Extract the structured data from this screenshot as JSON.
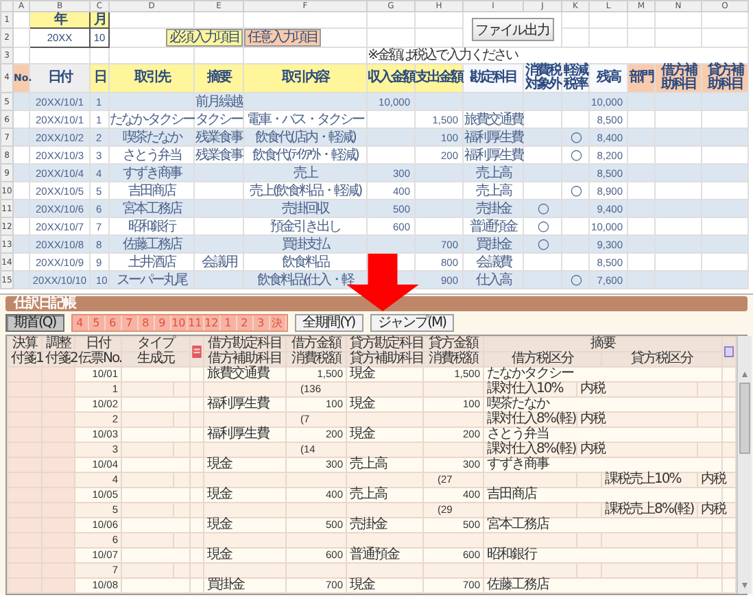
{
  "sheet": {
    "column_letters": [
      "A",
      "B",
      "C",
      "D",
      "E",
      "F",
      "G",
      "H",
      "I",
      "J",
      "K",
      "L",
      "M",
      "N",
      "O"
    ],
    "row_numbers": [
      "1",
      "2",
      "3",
      "4",
      "5",
      "6",
      "7",
      "8",
      "9",
      "10",
      "11",
      "12",
      "13",
      "14",
      "15"
    ],
    "year_label": "年",
    "month_label": "月",
    "year": "20XX",
    "month": "10",
    "legend": [
      {
        "label": "必須入力項目",
        "kind": "required"
      },
      {
        "label": "任意入力項目",
        "kind": "optional"
      }
    ],
    "export_button": "ファイル出力",
    "note": "※金額は税込で入力ください",
    "columns": [
      {
        "label": "No.",
        "kind": "optional"
      },
      {
        "label": "日付",
        "kind": "auto"
      },
      {
        "label": "日",
        "kind": "required"
      },
      {
        "label": "取引先",
        "kind": "required"
      },
      {
        "label": "摘要",
        "kind": "required"
      },
      {
        "label": "取引内容",
        "kind": "required"
      },
      {
        "label": "収入金額",
        "kind": "required"
      },
      {
        "label": "支出金額",
        "kind": "required"
      },
      {
        "label": "勘定科目",
        "kind": "computed"
      },
      {
        "label": "消費税対象外",
        "kind": "computed"
      },
      {
        "label": "軽減税率",
        "kind": "computed"
      },
      {
        "label": "残高",
        "kind": "computed"
      },
      {
        "label": "部門",
        "kind": "optional"
      },
      {
        "label": "借方補助科目",
        "kind": "optional"
      },
      {
        "label": "貸方補助科目",
        "kind": "optional"
      }
    ],
    "rows": [
      {
        "date": "20XX/10/1",
        "day": "1",
        "summary": "前月繰越",
        "income": "10,000",
        "balance": "10,000"
      },
      {
        "date": "20XX/10/1",
        "day": "1",
        "partner": "たなか-タクシー",
        "summary": "タクシー",
        "content": "電車・バス・タクシー",
        "expense": "1,500",
        "account": "旅費交通費",
        "balance": "8,500"
      },
      {
        "date": "20XX/10/2",
        "day": "2",
        "partner": "喫茶たなか",
        "summary": "残業食事",
        "content": "飲食代(店内・軽減)",
        "expense": "100",
        "account": "福利厚生費",
        "reduced_rate": "○",
        "balance": "8,400"
      },
      {
        "date": "20XX/10/3",
        "day": "3",
        "partner": "さとう弁当",
        "summary": "残業食事",
        "content": "飲食代(ﾃｲｸｱｳﾄ・軽減)",
        "expense": "200",
        "account": "福利厚生費",
        "reduced_rate": "○",
        "balance": "8,200"
      },
      {
        "date": "20XX/10/4",
        "day": "4",
        "partner": "すずき商事",
        "content": "売上",
        "income": "300",
        "account": "売上高",
        "balance": "8,500"
      },
      {
        "date": "20XX/10/5",
        "day": "5",
        "partner": "吉田商店",
        "content": "売上(飲食料品・軽減)",
        "income": "400",
        "account": "売上高",
        "reduced_rate": "○",
        "balance": "8,900"
      },
      {
        "date": "20XX/10/6",
        "day": "6",
        "partner": "宮本工務店",
        "content": "売掛回収",
        "income": "500",
        "account": "売掛金",
        "tax_exempt": "○",
        "balance": "9,400"
      },
      {
        "date": "20XX/10/7",
        "day": "7",
        "partner": "昭和銀行",
        "content": "預金引き出し",
        "income": "600",
        "account": "普通預金",
        "tax_exempt": "○",
        "balance": "10,000"
      },
      {
        "date": "20XX/10/8",
        "day": "8",
        "partner": "佐藤工務店",
        "content": "買掛支払",
        "expense": "700",
        "account": "買掛金",
        "tax_exempt": "○",
        "balance": "9,300"
      },
      {
        "date": "20XX/10/9",
        "day": "9",
        "partner": "土井酒店",
        "summary": "会議用",
        "content": "飲食料品",
        "expense": "800",
        "account": "会議費",
        "balance": "8,500"
      },
      {
        "date": "20XX/10/10",
        "day": "10",
        "partner": "スーパー丸尾",
        "content": "飲食料品(仕入・軽",
        "expense": "900",
        "account": "仕入高",
        "reduced_rate": "○",
        "balance": "7,600"
      }
    ]
  },
  "journal": {
    "title": "仕訳日記帳",
    "period_buttons": [
      {
        "label": "期首(Q)",
        "kind": "period",
        "selected": true
      },
      {
        "label": "4",
        "kind": "month",
        "selected": false
      },
      {
        "label": "5",
        "kind": "month",
        "selected": false
      },
      {
        "label": "6",
        "kind": "month",
        "selected": false
      },
      {
        "label": "7",
        "kind": "month",
        "selected": false
      },
      {
        "label": "8",
        "kind": "month",
        "selected": false
      },
      {
        "label": "9",
        "kind": "month",
        "selected": false
      },
      {
        "label": "10",
        "kind": "month",
        "selected": false
      },
      {
        "label": "11",
        "kind": "month",
        "selected": false
      },
      {
        "label": "12",
        "kind": "month",
        "selected": false
      },
      {
        "label": "1",
        "kind": "month",
        "selected": false
      },
      {
        "label": "2",
        "kind": "month",
        "selected": false
      },
      {
        "label": "3",
        "kind": "month",
        "selected": false
      },
      {
        "label": "決",
        "kind": "month",
        "selected": false
      },
      {
        "label": "全期間(Y)",
        "kind": "period",
        "selected": false
      }
    ],
    "jump_button": "ジャンプ(M)",
    "columns": [
      {
        "top": "決算",
        "bottom": "付箋1"
      },
      {
        "top": "調整",
        "bottom": "付箋2"
      },
      {
        "top": "日付",
        "bottom": "伝票No."
      },
      {
        "top": "タイプ",
        "bottom": "生成元"
      },
      {
        "top": "借方勘定科目",
        "bottom": "借方補助科目"
      },
      {
        "top": "借方金額",
        "bottom": "消費税額"
      },
      {
        "top": "貸方勘定科目",
        "bottom": "貸方補助科目"
      },
      {
        "top": "貸方金額",
        "bottom": "消費税額"
      }
    ],
    "memo_header": "摘要",
    "memo_sub": [
      "借方税区分",
      "貸方税区分"
    ],
    "entries": [
      {
        "date": "10/01",
        "slip": "1",
        "debit_account": "旅費交通費",
        "debit_amount": "1,500",
        "credit_account": "現金",
        "credit_amount": "1,500",
        "memo": "たなかタクシー",
        "debit_tax": "(136",
        "debit_tax_class": "課対仕入10%",
        "debit_tax_type": "内税"
      },
      {
        "date": "10/02",
        "slip": "2",
        "debit_account": "福利厚生費",
        "debit_amount": "100",
        "credit_account": "現金",
        "credit_amount": "100",
        "memo": "喫茶たなか",
        "debit_tax": "(7",
        "debit_tax_class": "課対仕入8%(軽)",
        "debit_tax_type": "内税"
      },
      {
        "date": "10/03",
        "slip": "3",
        "debit_account": "福利厚生費",
        "debit_amount": "200",
        "credit_account": "現金",
        "credit_amount": "200",
        "memo": "さとう弁当",
        "debit_tax": "(14",
        "debit_tax_class": "課対仕入8%(軽)",
        "debit_tax_type": "内税"
      },
      {
        "date": "10/04",
        "slip": "4",
        "debit_account": "現金",
        "debit_amount": "300",
        "credit_account": "売上高",
        "credit_amount": "300",
        "memo": "すずき商事",
        "credit_tax": "(27",
        "credit_tax_class": "課税売上10%",
        "credit_tax_type": "内税"
      },
      {
        "date": "10/05",
        "slip": "5",
        "debit_account": "現金",
        "debit_amount": "400",
        "credit_account": "売上高",
        "credit_amount": "400",
        "memo": "吉田商店",
        "credit_tax": "(29",
        "credit_tax_class": "課税売上8%(軽)",
        "credit_tax_type": "内税"
      },
      {
        "date": "10/06",
        "slip": "6",
        "debit_account": "現金",
        "debit_amount": "500",
        "credit_account": "売掛金",
        "credit_amount": "500",
        "memo": "宮本工務店"
      },
      {
        "date": "10/07",
        "slip": "7",
        "debit_account": "現金",
        "debit_amount": "600",
        "credit_account": "普通預金",
        "credit_amount": "600",
        "memo": "昭和銀行"
      },
      {
        "date": "10/08",
        "debit_account": "買掛金",
        "debit_amount": "700",
        "credit_account": "現金",
        "credit_amount": "700",
        "memo": "佐藤工務店"
      }
    ]
  }
}
